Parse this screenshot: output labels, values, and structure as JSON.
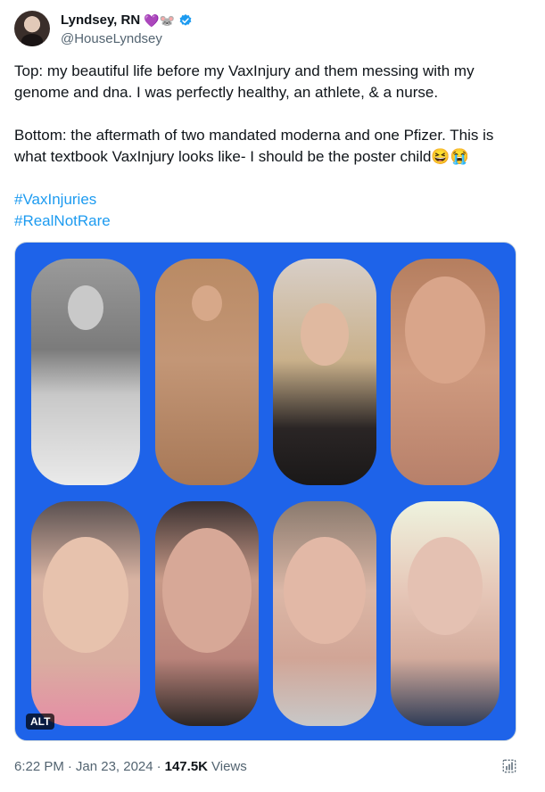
{
  "author": {
    "name": "Lyndsey, RN",
    "emojis": "💜🐭",
    "handle": "@HouseLyndsey"
  },
  "tweet": {
    "paragraph1": "Top: my beautiful life before my VaxInjury and them messing with my genome and dna. I was perfectly healthy, an athlete, & a nurse.",
    "paragraph2": "Bottom: the aftermath of two mandated moderna and one Pfizer. This is what textbook VaxInjury looks like- I should be the poster child😆😭",
    "hashtags": [
      "#VaxInjuries",
      "#RealNotRare"
    ]
  },
  "media": {
    "alt_badge": "ALT",
    "background_color": "#1e63e9"
  },
  "meta": {
    "time": "6:22 PM",
    "sep1": "·",
    "date": "Jan 23, 2024",
    "sep2": "·",
    "views_count": "147.5K",
    "views_label": "Views"
  },
  "colors": {
    "accent": "#1d9bf0",
    "verified": "#1d9bf0",
    "secondary_text": "#536471"
  }
}
